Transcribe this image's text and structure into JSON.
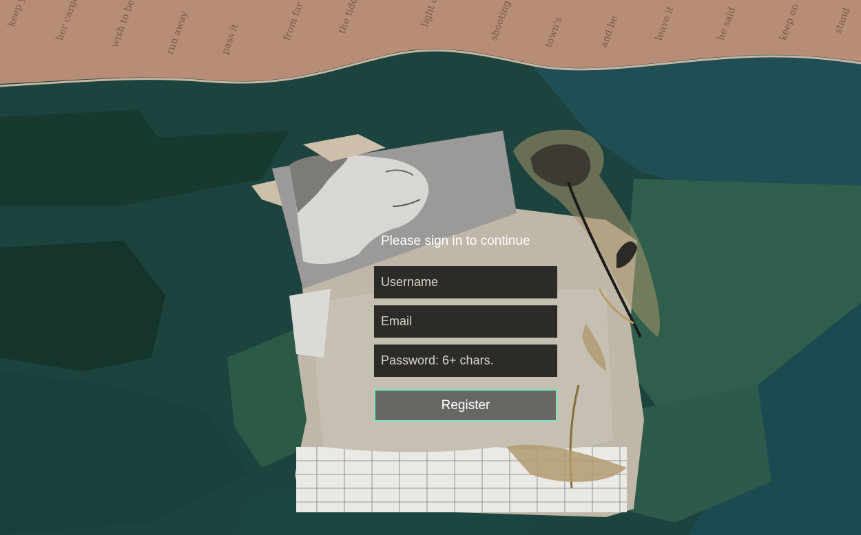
{
  "form": {
    "title": "Please sign in to continue",
    "username_placeholder": "Username",
    "email_placeholder": "Email",
    "password_placeholder": "Password: 6+ chars.",
    "register_label": "Register"
  },
  "colors": {
    "background_green": "#1d453f",
    "input_background": "#2d2b27",
    "button_background": "#686764",
    "button_border": "#7be6c2",
    "title_text": "#ffffff"
  },
  "decorations": {
    "background": "collage-background",
    "top_strip": "newspaper-strip-image",
    "statue": "statue-head-image",
    "flower": "dried-rose-image"
  }
}
